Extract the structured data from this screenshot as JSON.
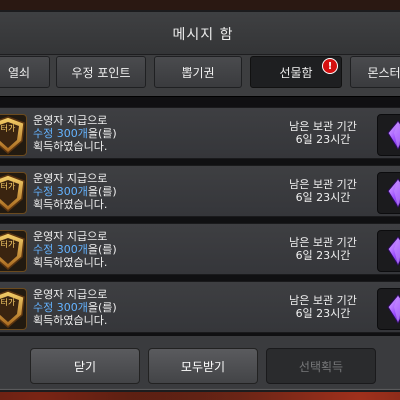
{
  "dialog": {
    "title": "메시지 함"
  },
  "tabs": [
    {
      "label": "열쇠",
      "active": false
    },
    {
      "label": "우정 포인트",
      "active": false
    },
    {
      "label": "뽑기권",
      "active": false
    },
    {
      "label": "선물함",
      "active": true,
      "badge": "!"
    },
    {
      "label": "몬스터",
      "active": false
    }
  ],
  "messages": [
    {
      "line1": "운영자 지급으로",
      "highlight": "수정 300개",
      "suffix": "을(를)",
      "line3": "획득하였습니다.",
      "remain_label": "남은 보관 기간",
      "remain_value": "6일 23시간",
      "icon_text": "터가",
      "item_icon": "purple-crystal-icon"
    },
    {
      "line1": "운영자 지급으로",
      "highlight": "수정 300개",
      "suffix": "을(를)",
      "line3": "획득하였습니다.",
      "remain_label": "남은 보관 기간",
      "remain_value": "6일 23시간",
      "icon_text": "터가",
      "item_icon": "purple-crystal-icon"
    },
    {
      "line1": "운영자 지급으로",
      "highlight": "수정 300개",
      "suffix": "을(를)",
      "line3": "획득하였습니다.",
      "remain_label": "남은 보관 기간",
      "remain_value": "6일 23시간",
      "icon_text": "터가",
      "item_icon": "purple-crystal-icon"
    },
    {
      "line1": "운영자 지급으로",
      "highlight": "수정 300개",
      "suffix": "을(를)",
      "line3": "획득하였습니다.",
      "remain_label": "남은 보관 기간",
      "remain_value": "6일 23시간",
      "icon_text": "터가",
      "item_icon": "purple-crystal-icon"
    }
  ],
  "footer": {
    "close_label": "닫기",
    "receive_all_label": "모두받기",
    "receive_selected_label": "선택획득"
  },
  "colors": {
    "highlight": "#64b3ff",
    "badge": "#d41010",
    "crystal": "#9b4dff"
  }
}
